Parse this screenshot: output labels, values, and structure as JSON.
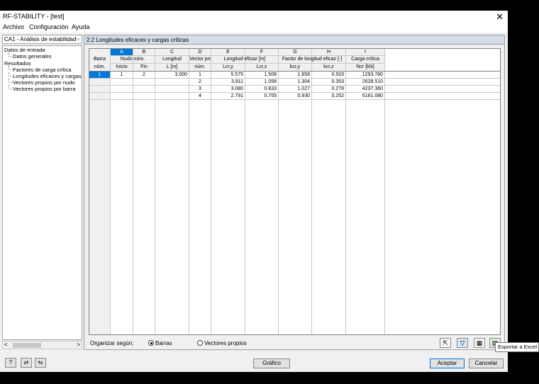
{
  "window": {
    "title": "RF-STABILITY - [test]",
    "close_glyph": "✕"
  },
  "menu": [
    "Archivo",
    "Configuración",
    "Ayuda"
  ],
  "case_selector": "CA1 - Análisis de estabilidad",
  "tree": [
    "Datos de entrada",
    "Datos generales",
    "Resultados",
    "Factores de carga crítica",
    "Longitudes eficaces y cargas críticas",
    "Vectores propios por nudo",
    "Vectores propios por barra"
  ],
  "pane_title": "2.2 Longitudes eficaces y cargas críticas",
  "table": {
    "column_letters": [
      "A",
      "B",
      "C",
      "D",
      "E",
      "F",
      "G",
      "H",
      "I"
    ],
    "header_row1": [
      "Barra",
      "Nudo núm.",
      "Longitud",
      "Vector pro",
      "Longitud eficaz [m]",
      "Factor de longitud eficaz [-]",
      "Carga crítica"
    ],
    "header_row2": [
      "núm.",
      "Inicio",
      "Fin",
      "L [m]",
      "núm.",
      "Lcr,y",
      "Lcr,z",
      "kcr,y",
      "kcr,z",
      "Ncr [kN]"
    ],
    "rows": [
      [
        "1",
        "1",
        "2",
        "3.000",
        "1",
        "5.575",
        "1.508",
        "1.858",
        "0.503",
        "1293.780"
      ],
      [
        "",
        "",
        "",
        "",
        "2",
        "3.911",
        "1.058",
        "1.304",
        "0.353",
        "2628.510"
      ],
      [
        "",
        "",
        "",
        "",
        "3",
        "3.080",
        "0.833",
        "1.027",
        "0.278",
        "4237.360"
      ],
      [
        "",
        "",
        "",
        "",
        "4",
        "2.791",
        "0.755",
        "0.930",
        "0.252",
        "5161.080"
      ]
    ]
  },
  "footer": {
    "organize_label": "Organizar según:",
    "radio_barras": "Barras",
    "radio_vectores": "Vectores propios"
  },
  "buttons": {
    "grafico": "Gráfico",
    "aceptar": "Aceptar",
    "cancelar": "Cancelar"
  },
  "tooltip": "Exportar a Excel",
  "colors": {
    "selection": "#0078d7",
    "header_bg": "#d4dce8"
  }
}
